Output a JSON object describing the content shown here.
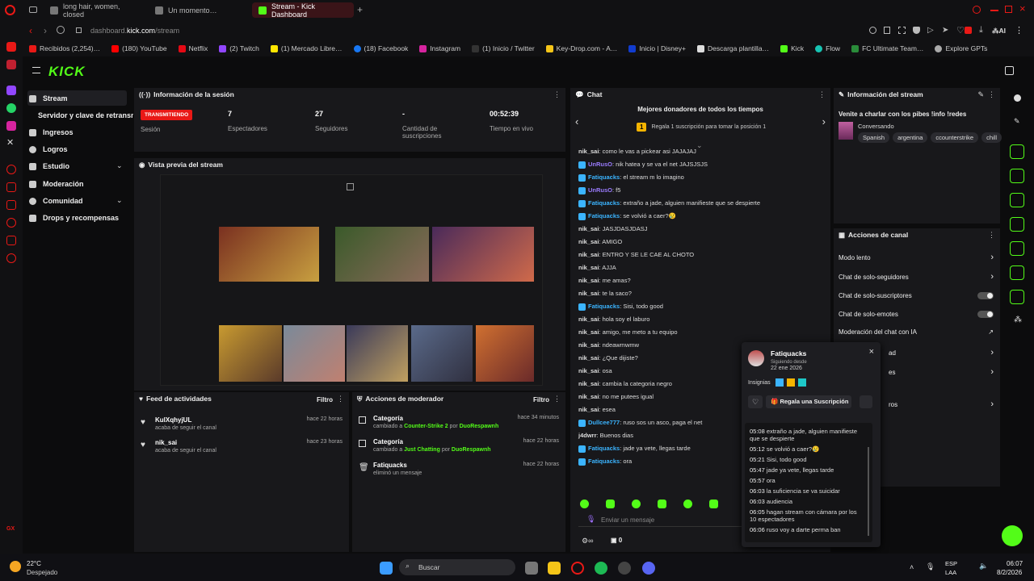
{
  "browser": {
    "tabs": [
      {
        "label": "long hair, women, closed"
      },
      {
        "label": "Un momento…"
      },
      {
        "label": "Stream - Kick Dashboard"
      }
    ],
    "url_host": "dashboard.",
    "url_domain": "kick.com",
    "url_path": "/stream",
    "ai_label": "AI"
  },
  "bookmarks": [
    "Recibidos (2,254)…",
    "(180) YouTube",
    "Netflix",
    "(2) Twitch",
    "(1) Mercado Libre…",
    "(18) Facebook",
    "Instagram",
    "(1) Inicio / Twitter",
    "Key-Drop.com - A…",
    "Inicio | Disney+",
    "Descarga plantilla…",
    "Kick",
    "Flow",
    "FC Ultimate Team…",
    "Explore GPTs"
  ],
  "sidebar": {
    "logo": "KICK",
    "items": [
      {
        "label": "Stream"
      },
      {
        "label": "Servidor y clave de retransmisión"
      },
      {
        "label": "Ingresos"
      },
      {
        "label": "Logros"
      },
      {
        "label": "Estudio"
      },
      {
        "label": "Moderación"
      },
      {
        "label": "Comunidad"
      },
      {
        "label": "Drops y recompensas"
      }
    ]
  },
  "session": {
    "title": "Información de la sesión",
    "status": "TRANSMITIENDO",
    "status_label": "Sesión",
    "viewers": "7",
    "viewers_label": "Espectadores",
    "followers": "27",
    "followers_label": "Seguidores",
    "subs": "-",
    "subs_label": "Cantidad de suscripciones",
    "time": "00:52:39",
    "time_label": "Tiempo en vivo"
  },
  "preview": {
    "title": "Vista previa del stream"
  },
  "feed": {
    "title": "Feed de actividades",
    "filter": "Filtro",
    "items": [
      {
        "name": "KulXqhyjUL",
        "sub": "acaba de seguir el canal",
        "time": "hace 22 horas"
      },
      {
        "name": "nik_sai",
        "sub": "acaba de seguir el canal",
        "time": "hace 23 horas"
      }
    ]
  },
  "modactions": {
    "title": "Acciones de moderador",
    "filter": "Filtro",
    "items": [
      {
        "name": "Categoría",
        "pre": "cambiado a ",
        "cat": "Counter-Strike 2",
        "by": " por ",
        "who": "DuoRespawnh",
        "time": "hace 34 minutos"
      },
      {
        "name": "Categoría",
        "pre": "cambiado a ",
        "cat": "Just Chatting",
        "by": " por ",
        "who": "DuoRespawnh",
        "time": "hace 22 horas"
      },
      {
        "name": "Fatiquacks",
        "pre": "eliminó un mensaje",
        "cat": "",
        "by": "",
        "who": "",
        "time": "hace 22 horas"
      }
    ]
  },
  "chat": {
    "title": "Chat",
    "donors_title": "Mejores donadores de todos los tiempos",
    "donors_rank": "1",
    "donors_text": "Regala 1 suscripción para tomar la posición 1",
    "input_placeholder": "Enviar un mensaje",
    "count": "0",
    "messages": [
      {
        "u": "nik_sai",
        "c": "u1",
        "t": ": como le vas a pickear asi JAJAJAJ"
      },
      {
        "u": "UnRusO",
        "c": "u2",
        "t": ": nik hatea y se va el net JAJSJSJS"
      },
      {
        "u": "Fatiquacks",
        "c": "u3",
        "t": ": el stream m lo imagino"
      },
      {
        "u": "UnRusO",
        "c": "u2",
        "t": ": f5"
      },
      {
        "u": "Fatiquacks",
        "c": "u3",
        "t": ": extraño a jade, alguien manifieste que se despierte"
      },
      {
        "u": "Fatiquacks",
        "c": "u3",
        "t": ": se volvió a caer?😢"
      },
      {
        "u": "nik_sai",
        "c": "u1",
        "t": ": JASJDASJDASJ"
      },
      {
        "u": "nik_sai",
        "c": "u1",
        "t": ": AMIGO"
      },
      {
        "u": "nik_sai",
        "c": "u1",
        "t": ": ENTRO Y SE LE CAE AL CHOTO"
      },
      {
        "u": "nik_sai",
        "c": "u1",
        "t": ": AJJA"
      },
      {
        "u": "nik_sai",
        "c": "u1",
        "t": ": me amas?"
      },
      {
        "u": "nik_sai",
        "c": "u1",
        "t": ": te la saco?"
      },
      {
        "u": "Fatiquacks",
        "c": "u3",
        "t": ": Sisi, todo good"
      },
      {
        "u": "nik_sai",
        "c": "u1",
        "t": ": hola soy el laburo"
      },
      {
        "u": "nik_sai",
        "c": "u1",
        "t": ": amigo, me meto a tu equipo"
      },
      {
        "u": "nik_sai",
        "c": "u1",
        "t": ": ndeawmwmw"
      },
      {
        "u": "nik_sai",
        "c": "u1",
        "t": ": ¿Que dijiste?"
      },
      {
        "u": "nik_sai",
        "c": "u1",
        "t": ": osa"
      },
      {
        "u": "nik_sai",
        "c": "u1",
        "t": ": cambia la categoria negro"
      },
      {
        "u": "nik_sai",
        "c": "u1",
        "t": ": no me putees igual"
      },
      {
        "u": "nik_sai",
        "c": "u1",
        "t": ": esea"
      },
      {
        "u": "Dullcee777",
        "c": "u3",
        "t": ": ruso sos un asco, paga el net"
      },
      {
        "u": "j4dwrr",
        "c": "u1",
        "t": ": Buenos dias"
      },
      {
        "u": "Fatiquacks",
        "c": "u3",
        "t": ": jade ya vete, llegas tarde"
      },
      {
        "u": "Fatiquacks",
        "c": "u3",
        "t": ": ora"
      }
    ]
  },
  "streaminfo": {
    "title": "Información del stream",
    "stream_title": "Venite a charlar con los pibes !info !redes",
    "category": "Conversando",
    "tags": [
      "Spanish",
      "argentina",
      "ccounterstrike",
      "chill"
    ]
  },
  "channel": {
    "title": "Acciones de canal",
    "items": [
      {
        "label": "Modo lento"
      },
      {
        "label": "Chat de solo-seguidores"
      },
      {
        "label": "Chat de solo-suscriptores"
      },
      {
        "label": "Chat de solo-emotes"
      },
      {
        "label": "Moderación del chat con IA"
      }
    ],
    "hidden": [
      "ad",
      "es",
      "ros"
    ]
  },
  "popup": {
    "name": "Fatiquacks",
    "following_label": "Siguiendo desde",
    "following_date": "22 ene 2026",
    "badges_label": "Insignias",
    "gift_button": "Regala una Suscripción",
    "history": [
      {
        "t": "05:08",
        "m": "extraño a jade, alguien manifieste que se despierte"
      },
      {
        "t": "05:12",
        "m": "se volvió a caer?😢"
      },
      {
        "t": "05:21",
        "m": "Sisi, todo good"
      },
      {
        "t": "05:47",
        "m": "jade ya vete, llegas tarde"
      },
      {
        "t": "05:57",
        "m": "ora"
      },
      {
        "t": "06:03",
        "m": "la suficiencia se va suicidar"
      },
      {
        "t": "06:03",
        "m": "audiencia"
      },
      {
        "t": "06:05",
        "m": "hagan stream con cámara por los 10 espectadores"
      },
      {
        "t": "06:06",
        "m": "ruso voy a darte perma ban"
      }
    ]
  },
  "taskbar": {
    "temp": "22°C",
    "weather": "Despejado",
    "search": "Buscar",
    "lang": "ESP",
    "region": "LAA",
    "time": "06:07",
    "date": "8/2/2026"
  },
  "colors": {
    "accent": "#53fc18",
    "live": "#e91916"
  }
}
